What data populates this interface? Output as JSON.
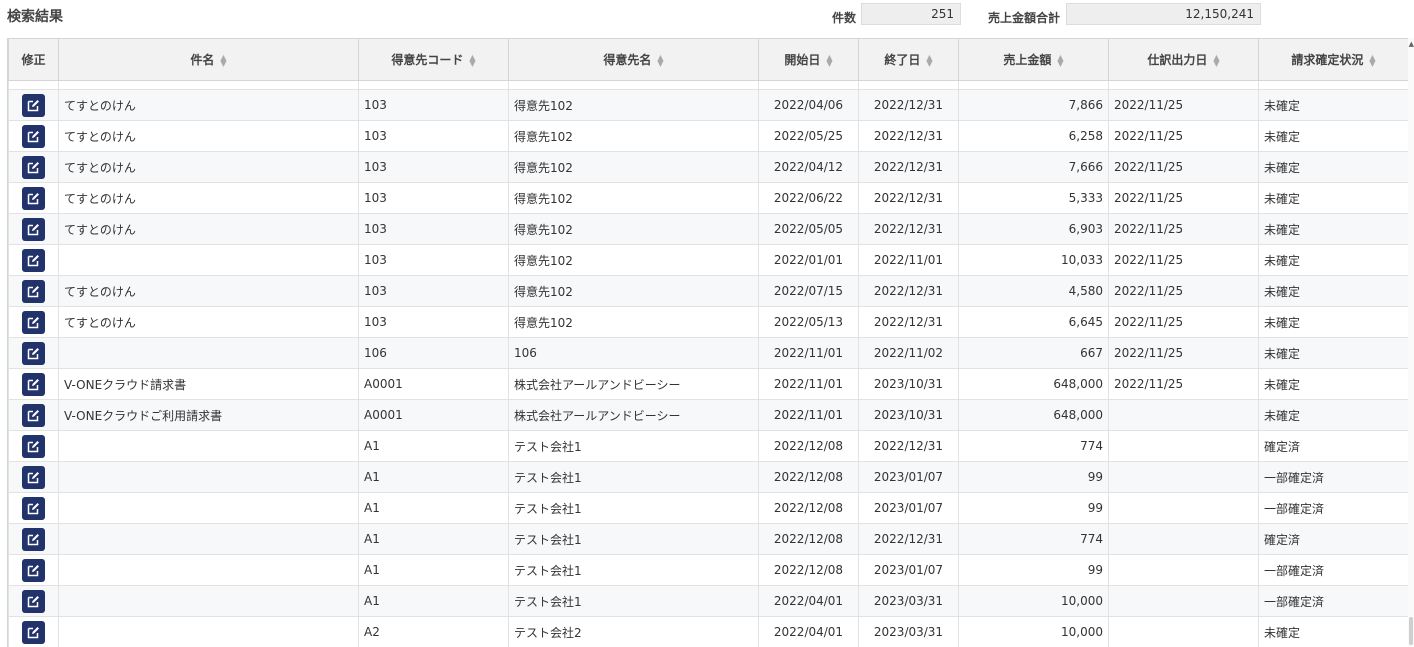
{
  "header": {
    "title": "検索結果"
  },
  "summary": {
    "count_label": "件数",
    "count_value": "251",
    "total_label": "売上金額合計",
    "total_value": "12,150,241"
  },
  "table": {
    "columns": [
      "修正",
      "件名",
      "得意先コード",
      "得意先名",
      "開始日",
      "終了日",
      "売上金額",
      "仕訳出力日",
      "請求確定状況"
    ],
    "rows": [
      {
        "subject": "てすとのけん",
        "code": "103",
        "customer": "得意先102",
        "start": "2022/04/06",
        "end": "2022/12/31",
        "amount": "7,866",
        "journal_date": "2022/11/25",
        "status": "未確定"
      },
      {
        "subject": "てすとのけん",
        "code": "103",
        "customer": "得意先102",
        "start": "2022/05/25",
        "end": "2022/12/31",
        "amount": "6,258",
        "journal_date": "2022/11/25",
        "status": "未確定"
      },
      {
        "subject": "てすとのけん",
        "code": "103",
        "customer": "得意先102",
        "start": "2022/04/12",
        "end": "2022/12/31",
        "amount": "7,666",
        "journal_date": "2022/11/25",
        "status": "未確定"
      },
      {
        "subject": "てすとのけん",
        "code": "103",
        "customer": "得意先102",
        "start": "2022/06/22",
        "end": "2022/12/31",
        "amount": "5,333",
        "journal_date": "2022/11/25",
        "status": "未確定"
      },
      {
        "subject": "てすとのけん",
        "code": "103",
        "customer": "得意先102",
        "start": "2022/05/05",
        "end": "2022/12/31",
        "amount": "6,903",
        "journal_date": "2022/11/25",
        "status": "未確定"
      },
      {
        "subject": "",
        "code": "103",
        "customer": "得意先102",
        "start": "2022/01/01",
        "end": "2022/11/01",
        "amount": "10,033",
        "journal_date": "2022/11/25",
        "status": "未確定"
      },
      {
        "subject": "てすとのけん",
        "code": "103",
        "customer": "得意先102",
        "start": "2022/07/15",
        "end": "2022/12/31",
        "amount": "4,580",
        "journal_date": "2022/11/25",
        "status": "未確定"
      },
      {
        "subject": "てすとのけん",
        "code": "103",
        "customer": "得意先102",
        "start": "2022/05/13",
        "end": "2022/12/31",
        "amount": "6,645",
        "journal_date": "2022/11/25",
        "status": "未確定"
      },
      {
        "subject": "",
        "code": "106",
        "customer": "106",
        "start": "2022/11/01",
        "end": "2022/11/02",
        "amount": "667",
        "journal_date": "2022/11/25",
        "status": "未確定"
      },
      {
        "subject": "V-ONEクラウド請求書",
        "code": "A0001",
        "customer": "株式会社アールアンドビーシー",
        "start": "2022/11/01",
        "end": "2023/10/31",
        "amount": "648,000",
        "journal_date": "2022/11/25",
        "status": "未確定"
      },
      {
        "subject": "V-ONEクラウドご利用請求書",
        "code": "A0001",
        "customer": "株式会社アールアンドビーシー",
        "start": "2022/11/01",
        "end": "2023/10/31",
        "amount": "648,000",
        "journal_date": "",
        "status": "未確定"
      },
      {
        "subject": "",
        "code": "A1",
        "customer": "テスト会社1",
        "start": "2022/12/08",
        "end": "2022/12/31",
        "amount": "774",
        "journal_date": "",
        "status": "確定済"
      },
      {
        "subject": "",
        "code": "A1",
        "customer": "テスト会社1",
        "start": "2022/12/08",
        "end": "2023/01/07",
        "amount": "99",
        "journal_date": "",
        "status": "一部確定済"
      },
      {
        "subject": "",
        "code": "A1",
        "customer": "テスト会社1",
        "start": "2022/12/08",
        "end": "2023/01/07",
        "amount": "99",
        "journal_date": "",
        "status": "一部確定済"
      },
      {
        "subject": "",
        "code": "A1",
        "customer": "テスト会社1",
        "start": "2022/12/08",
        "end": "2022/12/31",
        "amount": "774",
        "journal_date": "",
        "status": "確定済"
      },
      {
        "subject": "",
        "code": "A1",
        "customer": "テスト会社1",
        "start": "2022/12/08",
        "end": "2023/01/07",
        "amount": "99",
        "journal_date": "",
        "status": "一部確定済"
      },
      {
        "subject": "",
        "code": "A1",
        "customer": "テスト会社1",
        "start": "2022/04/01",
        "end": "2023/03/31",
        "amount": "10,000",
        "journal_date": "",
        "status": "一部確定済"
      },
      {
        "subject": "",
        "code": "A2",
        "customer": "テスト会社2",
        "start": "2022/04/01",
        "end": "2023/03/31",
        "amount": "10,000",
        "journal_date": "",
        "status": "未確定"
      }
    ]
  },
  "icons": {
    "edit": "edit-icon",
    "sort": "sort-icon"
  },
  "colors": {
    "edit_button": "#22336b",
    "header_bg": "#f2f2f2",
    "row_alt_bg": "#f7f8fa"
  }
}
